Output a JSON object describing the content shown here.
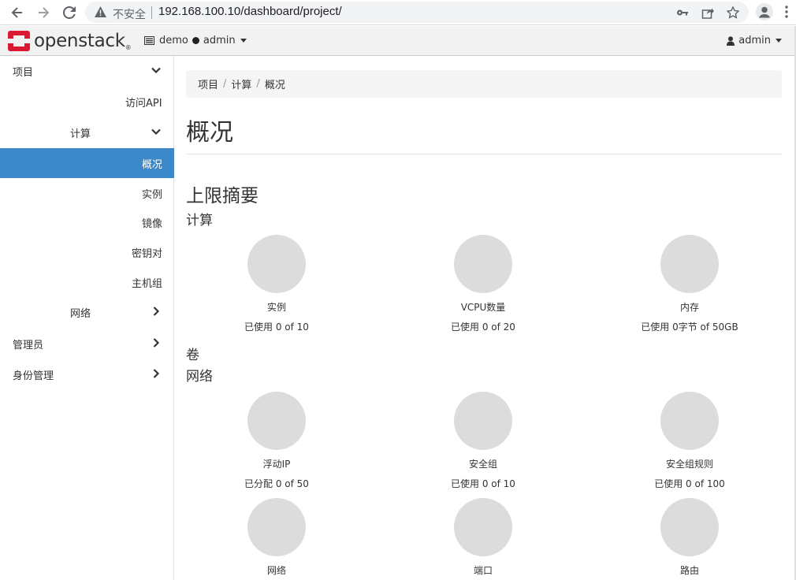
{
  "browser": {
    "security_label": "不安全",
    "url": "192.168.100.10/dashboard/project/"
  },
  "header": {
    "logo_text": "openstack",
    "project_name": "demo",
    "domain_name": "admin",
    "user_name": "admin"
  },
  "sidebar": {
    "items": [
      {
        "label": "项目"
      },
      {
        "label": "访问API"
      },
      {
        "label": "计算"
      },
      {
        "label": "概况"
      },
      {
        "label": "实例"
      },
      {
        "label": "镜像"
      },
      {
        "label": "密钥对"
      },
      {
        "label": "主机组"
      },
      {
        "label": "网络"
      },
      {
        "label": "管理员"
      },
      {
        "label": "身份管理"
      }
    ]
  },
  "breadcrumb": [
    "项目",
    "计算",
    "概况"
  ],
  "page_title": "概况",
  "limits_title": "上限摘要",
  "sections": {
    "compute": {
      "title": "计算",
      "charts": [
        {
          "title": "实例",
          "usage": "已使用 0 of 10"
        },
        {
          "title": "VCPU数量",
          "usage": "已使用 0 of 20"
        },
        {
          "title": "内存",
          "usage": "已使用 0字节 of 50GB"
        }
      ]
    },
    "volume": {
      "title": "卷"
    },
    "network": {
      "title": "网络",
      "charts": [
        {
          "title": "浮动IP",
          "usage": "已分配 0 of 50"
        },
        {
          "title": "安全组",
          "usage": "已使用 0 of 10"
        },
        {
          "title": "安全组规则",
          "usage": "已使用 0 of 100"
        },
        {
          "title": "网络",
          "usage": ""
        },
        {
          "title": "端口",
          "usage": ""
        },
        {
          "title": "路由",
          "usage": ""
        }
      ]
    }
  },
  "colors": {
    "active_sidebar": "#3c88c8",
    "logo_red": "#da1a32",
    "pie_empty": "#dcdcdc"
  }
}
